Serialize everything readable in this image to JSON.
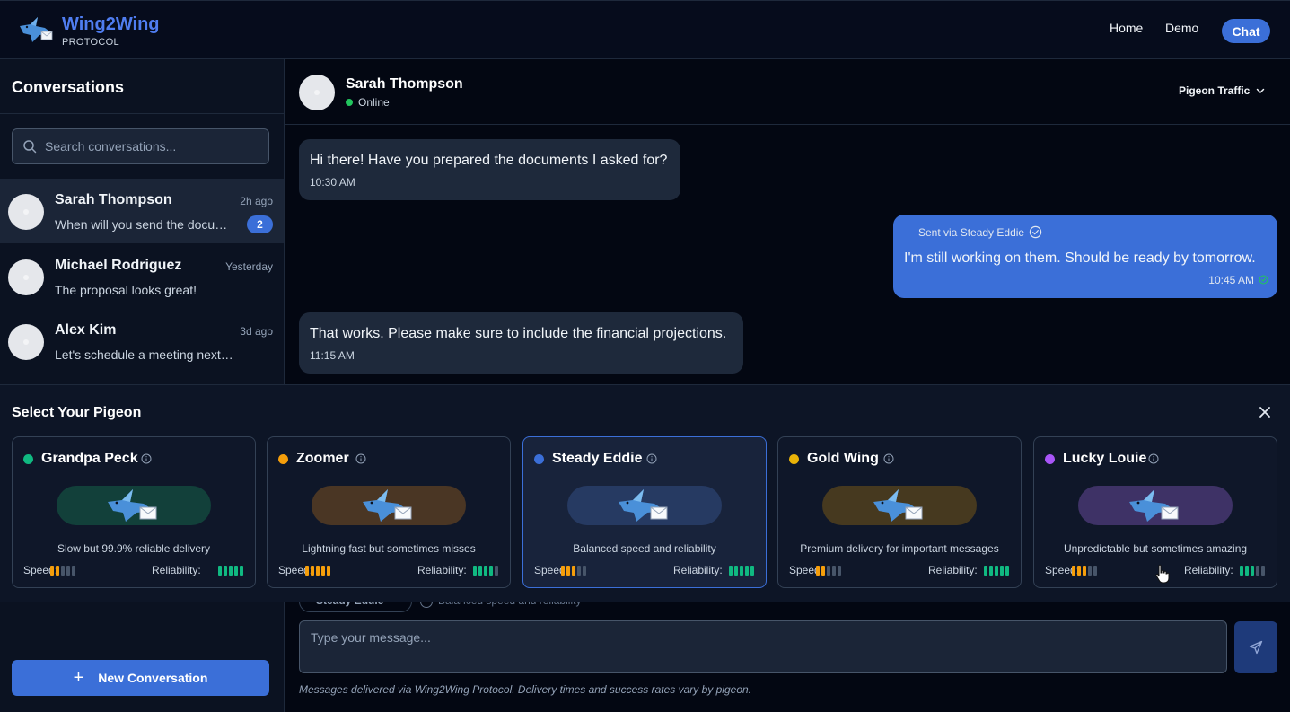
{
  "header": {
    "brand_name": "Wing2Wing",
    "brand_sub": "PROTOCOL",
    "logo_icon": "pigeon-envelope-icon",
    "nav": [
      {
        "label": "Home"
      },
      {
        "label": "Demo"
      },
      {
        "label": "Chat"
      }
    ]
  },
  "sidebar": {
    "title": "Conversations",
    "search": {
      "placeholder": "Search conversations...",
      "value": ""
    },
    "conversations": [
      {
        "name": "Sarah Thompson",
        "time": "2h ago",
        "preview": "When will you send the documents?",
        "unread": "2"
      },
      {
        "name": "Michael Rodriguez",
        "time": "Yesterday",
        "preview": "The proposal looks great!",
        "unread": ""
      },
      {
        "name": "Alex Kim",
        "time": "3d ago",
        "preview": "Let's schedule a meeting next week",
        "unread": ""
      }
    ],
    "new_button": "New Conversation"
  },
  "chat": {
    "contact_name": "Sarah Thompson",
    "status": "Online",
    "traffic_label": "Pigeon Traffic",
    "messages": [
      {
        "direction": "in",
        "text": "Hi there! Have you prepared the documents I asked for?",
        "time": "10:30 AM"
      },
      {
        "direction": "out",
        "sent_via": "Sent via Steady Eddie",
        "text": "I'm still working on them. Should be ready by tomorrow.",
        "time": "10:45 AM"
      },
      {
        "direction": "in",
        "text": "That works. Please make sure to include the financial projections.",
        "time": "11:15 AM"
      }
    ]
  },
  "pigeon_panel": {
    "title": "Select Your Pigeon",
    "speed_label": "Speed:",
    "reliability_label": "Reliability:",
    "pigeons": [
      {
        "name": "Grandpa Peck",
        "color": "#10b981",
        "bg": "#12403a",
        "description": "Slow but 99.9% reliable delivery",
        "speed": 2,
        "reliability": 5,
        "selected": false
      },
      {
        "name": "Zoomer",
        "color": "#f59e0b",
        "bg": "#4a3624",
        "description": "Lightning fast but sometimes misses",
        "speed": 5,
        "reliability": 4,
        "selected": false
      },
      {
        "name": "Steady Eddie",
        "color": "#3b6fd8",
        "bg": "#263a62",
        "description": "Balanced speed and reliability",
        "speed": 3,
        "reliability": 5,
        "selected": true
      },
      {
        "name": "Gold Wing",
        "color": "#eab308",
        "bg": "#46391f",
        "description": "Premium delivery for important messages",
        "speed": 2,
        "reliability": 5,
        "selected": false
      },
      {
        "name": "Lucky Louie",
        "color": "#a855f7",
        "bg": "#3e3266",
        "description": "Unpredictable but sometimes amazing",
        "speed": 3,
        "reliability": 3,
        "selected": false
      }
    ]
  },
  "composer": {
    "selected_pigeon": "Steady Eddie",
    "hint": "Balanced speed and reliability",
    "placeholder": "Type your message...",
    "value": "",
    "footer": "Messages delivered via Wing2Wing Protocol. Delivery times and success rates vary by pigeon."
  }
}
